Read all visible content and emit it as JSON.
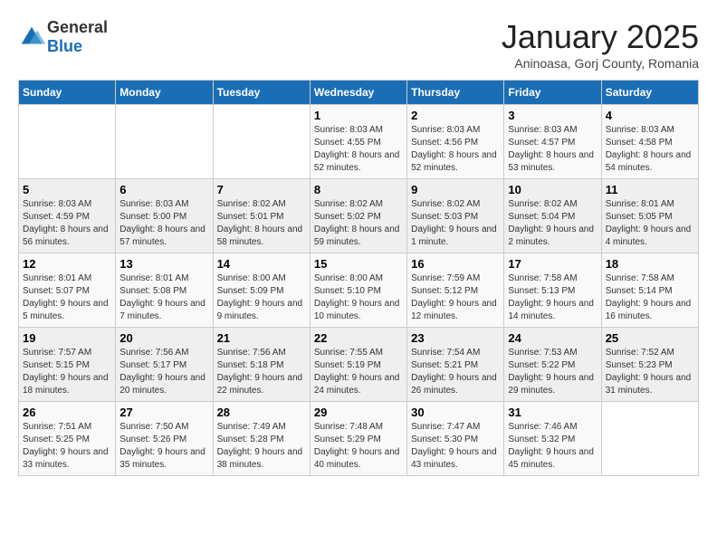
{
  "logo": {
    "text_general": "General",
    "text_blue": "Blue"
  },
  "title": "January 2025",
  "subtitle": "Aninoasa, Gorj County, Romania",
  "headers": [
    "Sunday",
    "Monday",
    "Tuesday",
    "Wednesday",
    "Thursday",
    "Friday",
    "Saturday"
  ],
  "weeks": [
    [
      {
        "day": "",
        "info": ""
      },
      {
        "day": "",
        "info": ""
      },
      {
        "day": "",
        "info": ""
      },
      {
        "day": "1",
        "info": "Sunrise: 8:03 AM\nSunset: 4:55 PM\nDaylight: 8 hours and 52 minutes."
      },
      {
        "day": "2",
        "info": "Sunrise: 8:03 AM\nSunset: 4:56 PM\nDaylight: 8 hours and 52 minutes."
      },
      {
        "day": "3",
        "info": "Sunrise: 8:03 AM\nSunset: 4:57 PM\nDaylight: 8 hours and 53 minutes."
      },
      {
        "day": "4",
        "info": "Sunrise: 8:03 AM\nSunset: 4:58 PM\nDaylight: 8 hours and 54 minutes."
      }
    ],
    [
      {
        "day": "5",
        "info": "Sunrise: 8:03 AM\nSunset: 4:59 PM\nDaylight: 8 hours and 56 minutes."
      },
      {
        "day": "6",
        "info": "Sunrise: 8:03 AM\nSunset: 5:00 PM\nDaylight: 8 hours and 57 minutes."
      },
      {
        "day": "7",
        "info": "Sunrise: 8:02 AM\nSunset: 5:01 PM\nDaylight: 8 hours and 58 minutes."
      },
      {
        "day": "8",
        "info": "Sunrise: 8:02 AM\nSunset: 5:02 PM\nDaylight: 8 hours and 59 minutes."
      },
      {
        "day": "9",
        "info": "Sunrise: 8:02 AM\nSunset: 5:03 PM\nDaylight: 9 hours and 1 minute."
      },
      {
        "day": "10",
        "info": "Sunrise: 8:02 AM\nSunset: 5:04 PM\nDaylight: 9 hours and 2 minutes."
      },
      {
        "day": "11",
        "info": "Sunrise: 8:01 AM\nSunset: 5:05 PM\nDaylight: 9 hours and 4 minutes."
      }
    ],
    [
      {
        "day": "12",
        "info": "Sunrise: 8:01 AM\nSunset: 5:07 PM\nDaylight: 9 hours and 5 minutes."
      },
      {
        "day": "13",
        "info": "Sunrise: 8:01 AM\nSunset: 5:08 PM\nDaylight: 9 hours and 7 minutes."
      },
      {
        "day": "14",
        "info": "Sunrise: 8:00 AM\nSunset: 5:09 PM\nDaylight: 9 hours and 9 minutes."
      },
      {
        "day": "15",
        "info": "Sunrise: 8:00 AM\nSunset: 5:10 PM\nDaylight: 9 hours and 10 minutes."
      },
      {
        "day": "16",
        "info": "Sunrise: 7:59 AM\nSunset: 5:12 PM\nDaylight: 9 hours and 12 minutes."
      },
      {
        "day": "17",
        "info": "Sunrise: 7:58 AM\nSunset: 5:13 PM\nDaylight: 9 hours and 14 minutes."
      },
      {
        "day": "18",
        "info": "Sunrise: 7:58 AM\nSunset: 5:14 PM\nDaylight: 9 hours and 16 minutes."
      }
    ],
    [
      {
        "day": "19",
        "info": "Sunrise: 7:57 AM\nSunset: 5:15 PM\nDaylight: 9 hours and 18 minutes."
      },
      {
        "day": "20",
        "info": "Sunrise: 7:56 AM\nSunset: 5:17 PM\nDaylight: 9 hours and 20 minutes."
      },
      {
        "day": "21",
        "info": "Sunrise: 7:56 AM\nSunset: 5:18 PM\nDaylight: 9 hours and 22 minutes."
      },
      {
        "day": "22",
        "info": "Sunrise: 7:55 AM\nSunset: 5:19 PM\nDaylight: 9 hours and 24 minutes."
      },
      {
        "day": "23",
        "info": "Sunrise: 7:54 AM\nSunset: 5:21 PM\nDaylight: 9 hours and 26 minutes."
      },
      {
        "day": "24",
        "info": "Sunrise: 7:53 AM\nSunset: 5:22 PM\nDaylight: 9 hours and 29 minutes."
      },
      {
        "day": "25",
        "info": "Sunrise: 7:52 AM\nSunset: 5:23 PM\nDaylight: 9 hours and 31 minutes."
      }
    ],
    [
      {
        "day": "26",
        "info": "Sunrise: 7:51 AM\nSunset: 5:25 PM\nDaylight: 9 hours and 33 minutes."
      },
      {
        "day": "27",
        "info": "Sunrise: 7:50 AM\nSunset: 5:26 PM\nDaylight: 9 hours and 35 minutes."
      },
      {
        "day": "28",
        "info": "Sunrise: 7:49 AM\nSunset: 5:28 PM\nDaylight: 9 hours and 38 minutes."
      },
      {
        "day": "29",
        "info": "Sunrise: 7:48 AM\nSunset: 5:29 PM\nDaylight: 9 hours and 40 minutes."
      },
      {
        "day": "30",
        "info": "Sunrise: 7:47 AM\nSunset: 5:30 PM\nDaylight: 9 hours and 43 minutes."
      },
      {
        "day": "31",
        "info": "Sunrise: 7:46 AM\nSunset: 5:32 PM\nDaylight: 9 hours and 45 minutes."
      },
      {
        "day": "",
        "info": ""
      }
    ]
  ]
}
